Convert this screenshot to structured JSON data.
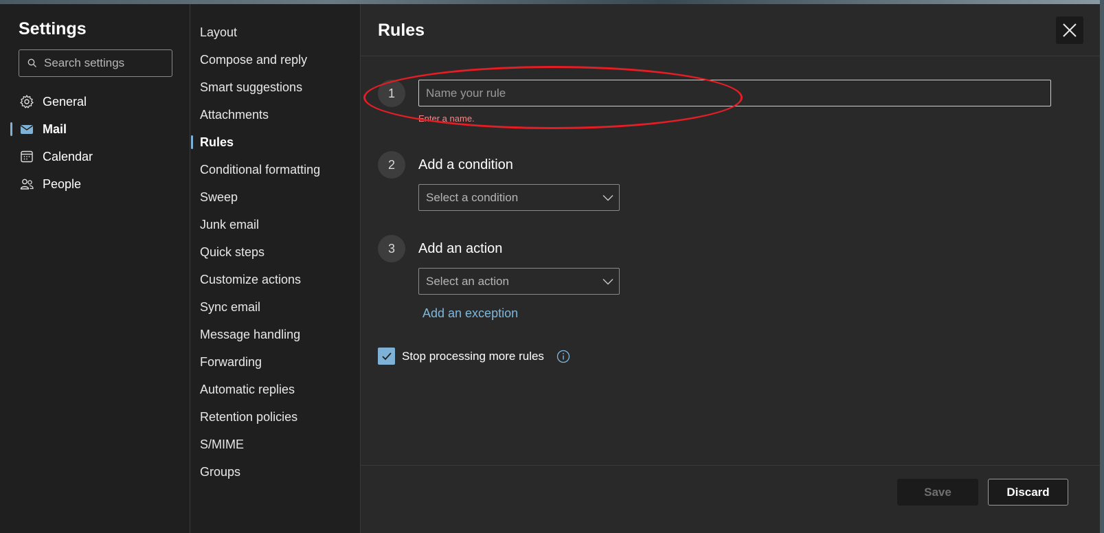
{
  "sidebar": {
    "title": "Settings",
    "search_placeholder": "Search settings",
    "items": [
      {
        "label": "General",
        "icon": "gear-icon"
      },
      {
        "label": "Mail",
        "icon": "mail-icon",
        "active": true
      },
      {
        "label": "Calendar",
        "icon": "calendar-icon"
      },
      {
        "label": "People",
        "icon": "people-icon"
      }
    ]
  },
  "subnav": {
    "items": [
      "Layout",
      "Compose and reply",
      "Smart suggestions",
      "Attachments",
      "Rules",
      "Conditional formatting",
      "Sweep",
      "Junk email",
      "Quick steps",
      "Customize actions",
      "Sync email",
      "Message handling",
      "Forwarding",
      "Automatic replies",
      "Retention policies",
      "S/MIME",
      "Groups"
    ],
    "active": "Rules"
  },
  "rules": {
    "title": "Rules",
    "step1": {
      "number": "1",
      "placeholder": "Name your rule",
      "error": "Enter a name."
    },
    "step2": {
      "number": "2",
      "title": "Add a condition",
      "dropdown": "Select a condition"
    },
    "step3": {
      "number": "3",
      "title": "Add an action",
      "dropdown": "Select an action"
    },
    "exception_link": "Add an exception",
    "stop_processing": {
      "label": "Stop processing more rules",
      "checked": true
    }
  },
  "footer": {
    "save_label": "Save",
    "discard_label": "Discard"
  },
  "colors": {
    "accent": "#7fb1d6",
    "error": "#f08a8a",
    "annotation": "#e51d25"
  }
}
